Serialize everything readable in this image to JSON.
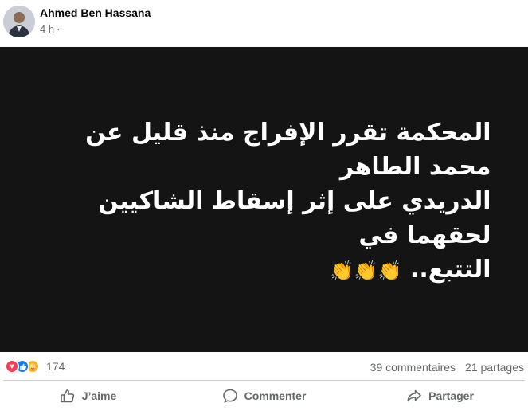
{
  "post": {
    "author": "Ahmed Ben Hassana",
    "time": "4 h",
    "separator": "·",
    "text_line1": "المحكمة تقرر الإفراج منذ قليل عن محمد الطاهر",
    "text_line2": "الدريدي على إثر إسقاط الشاكيين لحقهما في",
    "text_line3": "التتبع..",
    "emoji": "👏👏👏",
    "card_background": "#141414",
    "text_color": "#ffffff"
  },
  "stats": {
    "reaction_icons": [
      "love-icon",
      "like-icon",
      "care-icon"
    ],
    "reaction_count": "174",
    "comments": "39 commentaires",
    "shares": "21 partages"
  },
  "actions": {
    "like_label": "J’aime",
    "comment_label": "Commenter",
    "share_label": "Partager"
  },
  "colors": {
    "secondary_text": "#65676b",
    "like_blue": "#1877f2",
    "love_red": "#f33e58",
    "care_yellow": "#f7b125"
  }
}
